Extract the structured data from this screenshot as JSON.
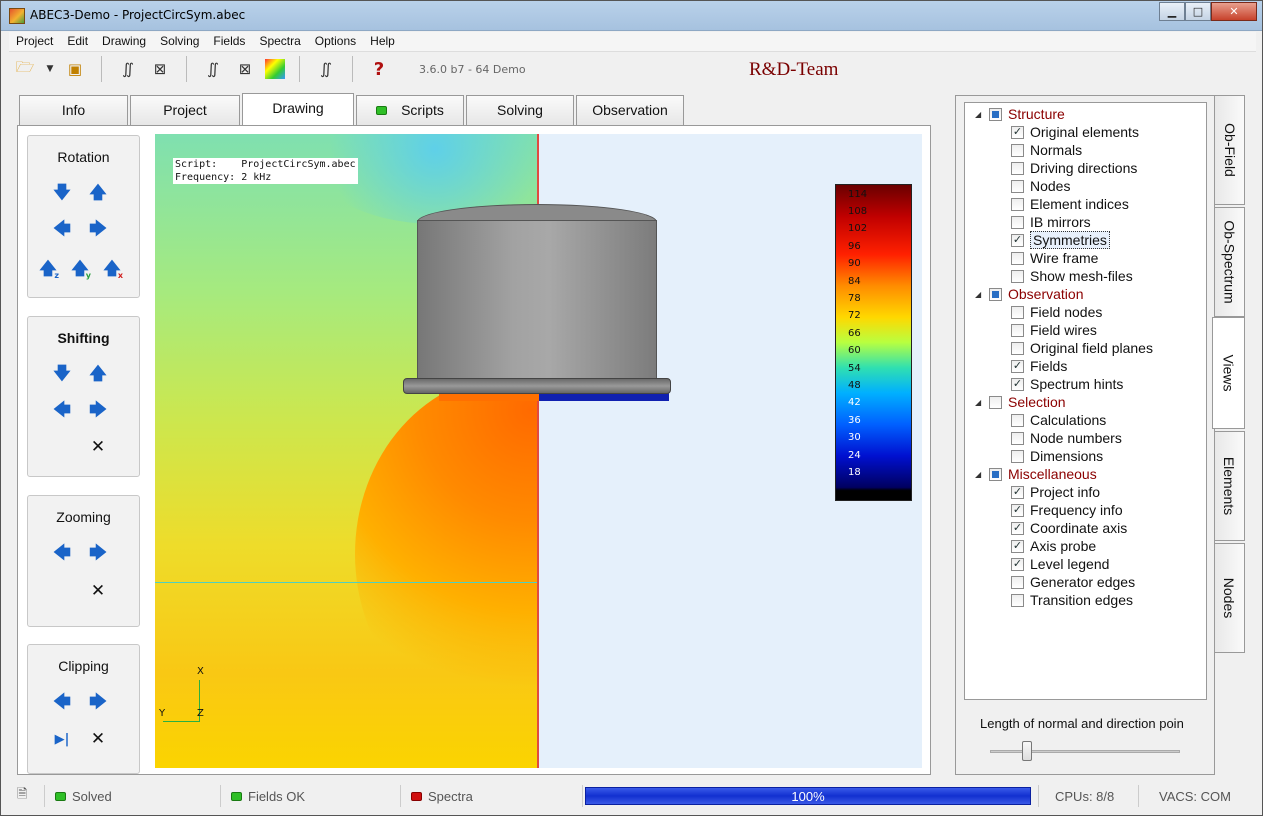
{
  "window": {
    "title": "ABEC3-Demo - ProjectCircSym.abec",
    "min_glyph": "▁",
    "max_glyph": "□",
    "close_glyph": "✕"
  },
  "menu": [
    "Project",
    "Edit",
    "Drawing",
    "Solving",
    "Fields",
    "Spectra",
    "Options",
    "Help"
  ],
  "toolbar": {
    "version": "3.6.0 b7 - 64 Demo",
    "brand": "R&D-Team"
  },
  "tabs": [
    {
      "label": "Info",
      "active": false
    },
    {
      "label": "Project",
      "active": false
    },
    {
      "label": "Drawing",
      "active": true
    },
    {
      "label": "Scripts",
      "active": false,
      "indicator": "green"
    },
    {
      "label": "Solving",
      "active": false
    },
    {
      "label": "Observation",
      "active": false
    }
  ],
  "controls": {
    "rotation": "Rotation",
    "shifting": "Shifting",
    "zooming": "Zooming",
    "clipping": "Clipping"
  },
  "viewport": {
    "script_line": "Script:    ProjectCircSym.abec",
    "freq_line": "Frequency: 2 kHz",
    "legend_levels": [
      "114",
      "108",
      "102",
      "96",
      "90",
      "84",
      "78",
      "72",
      "66",
      "60",
      "54",
      "48",
      "42",
      "36",
      "30",
      "24",
      "18"
    ],
    "axes": {
      "x": "X",
      "y": "Y",
      "z": "Z"
    }
  },
  "tree": [
    {
      "label": "Structure",
      "type": "category",
      "state": "partial"
    },
    {
      "label": "Original elements",
      "checked": true
    },
    {
      "label": "Normals",
      "checked": false
    },
    {
      "label": "Driving directions",
      "checked": false
    },
    {
      "label": "Nodes",
      "checked": false
    },
    {
      "label": "Element indices",
      "checked": false
    },
    {
      "label": "IB mirrors",
      "checked": false
    },
    {
      "label": "Symmetries",
      "checked": true,
      "selected": true
    },
    {
      "label": "Wire frame",
      "checked": false
    },
    {
      "label": "Show mesh-files",
      "checked": false
    },
    {
      "label": "Observation",
      "type": "category",
      "state": "partial"
    },
    {
      "label": "Field nodes",
      "checked": false
    },
    {
      "label": "Field wires",
      "checked": false
    },
    {
      "label": "Original field planes",
      "checked": false
    },
    {
      "label": "Fields",
      "checked": true
    },
    {
      "label": "Spectrum hints",
      "checked": true
    },
    {
      "label": "Selection",
      "type": "category",
      "state": "unchecked"
    },
    {
      "label": "Calculations",
      "checked": false
    },
    {
      "label": "Node numbers",
      "checked": false
    },
    {
      "label": "Dimensions",
      "checked": false
    },
    {
      "label": "Miscellaneous",
      "type": "category",
      "state": "partial"
    },
    {
      "label": "Project info",
      "checked": true
    },
    {
      "label": "Frequency info",
      "checked": true
    },
    {
      "label": "Coordinate axis",
      "checked": true
    },
    {
      "label": "Axis probe",
      "checked": true
    },
    {
      "label": "Level legend",
      "checked": true
    },
    {
      "label": "Generator edges",
      "checked": false
    },
    {
      "label": "Transition edges",
      "checked": false
    }
  ],
  "slider": {
    "label": "Length of normal and direction poin"
  },
  "side_tabs": [
    {
      "label": "Ob-Field",
      "active": false
    },
    {
      "label": "Ob-Spectrum",
      "active": false
    },
    {
      "label": "Views",
      "active": true
    },
    {
      "label": "Elements",
      "active": false
    },
    {
      "label": "Nodes",
      "active": false
    }
  ],
  "status": {
    "solved": "Solved",
    "fields": "Fields OK",
    "spectra": "Spectra",
    "progress": "100%",
    "cpus": "CPUs: 8/8",
    "vacs": "VACS: COM",
    "colors": {
      "ok": "#2fbf27",
      "error": "#d01010",
      "progress": "#1a3ad8"
    }
  }
}
